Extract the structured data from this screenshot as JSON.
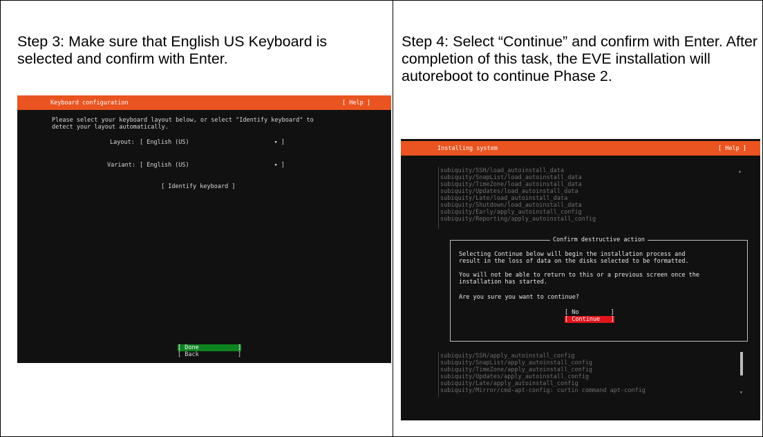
{
  "steps": {
    "step3_text": "Step 3: Make sure that English US Keyboard is selected and confirm with Enter.",
    "step4_text": "Step 4: Select “Continue” and confirm with Enter. After completion of this task, the EVE installation will autoreboot to continue Phase 2."
  },
  "keyboard_screen": {
    "title": "Keyboard configuration",
    "help": "[ Help ]",
    "intro_line1": "Please select your keyboard layout below, or select \"Identify keyboard\" to",
    "intro_line2": "detect your layout automatically.",
    "layout_label": "Layout:",
    "layout_value": "[ English (US)                        ▾ ]",
    "variant_label": "Variant:",
    "variant_value": "[ English (US)                        ▾ ]",
    "identify_button": "[ Identify keyboard ]",
    "done_button": "[ Done           ]",
    "back_button": "[ Back           ]"
  },
  "install_screen": {
    "title": "Installing system",
    "help": "[ Help ]",
    "log_top": [
      "subiquity/SSH/load_autoinstall_data",
      "subiquity/SnapList/load_autoinstall_data",
      "subiquity/TimeZone/load_autoinstall_data",
      "subiquity/Updates/load_autoinstall_data",
      "subiquity/Late/load_autoinstall_data",
      "subiquity/Shutdown/load_autoinstall_data",
      "subiquity/Early/apply_autoinstall_config",
      "subiquity/Reporting/apply_autoinstall_config"
    ],
    "dialog": {
      "title": "Confirm destructive action",
      "p1_line1": "Selecting Continue below will begin the installation process and",
      "p1_line2": "result in the loss of data on the disks selected to be formatted.",
      "p2_line1": "You will not be able to return to this or a previous screen once the",
      "p2_line2": "installation has started.",
      "question": "Are you sure you want to continue?",
      "no_button": "[ No         ]",
      "continue_button": "[ Continue   ]"
    },
    "log_bottom": [
      "subiquity/SSH/apply_autoinstall_config",
      "subiquity/SnapList/apply_autoinstall_config",
      "subiquity/TimeZone/apply_autoinstall_config",
      "subiquity/Updates/apply_autoinstall_config",
      "subiquity/Late/apply_autoinstall_config",
      "subiquity/Mirror/cmd-apt-config: curtin command apt-config"
    ]
  },
  "colors": {
    "ubuntu_orange": "#e95420",
    "selected_green": "#0e8420",
    "danger_red": "#e0151c",
    "terminal_bg": "#111111"
  }
}
